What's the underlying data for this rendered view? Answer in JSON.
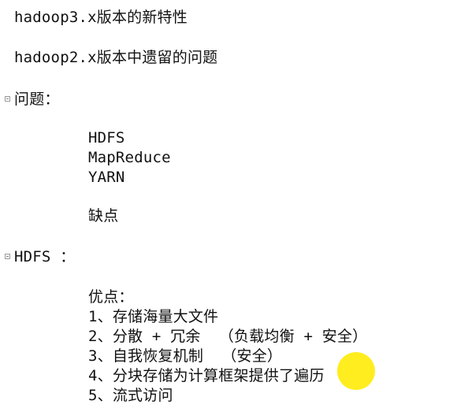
{
  "lines": {
    "title1": "hadoop3.x版本的新特性",
    "title2": "hadoop2.x版本中遗留的问题",
    "problem_label": "问题：",
    "item_hdfs": "HDFS",
    "item_mapreduce": "MapReduce",
    "item_yarn": "YARN",
    "drawback": "缺点",
    "hdfs_section": "HDFS ：",
    "advantages": "优点：",
    "adv1": "1、存储海量大文件",
    "adv2": "2、分散 + 冗余  （负载均衡 + 安全）",
    "adv3": "3、自我恢复机制  （安全）",
    "adv4_prefix": "4、分块存储为计算框架提供了",
    "adv4_highlight": "遍历",
    "adv5": "5、流式访问"
  },
  "colors": {
    "text": "#111111",
    "highlight": "#ffeb00",
    "fold_marker": "#9a9a9a"
  }
}
